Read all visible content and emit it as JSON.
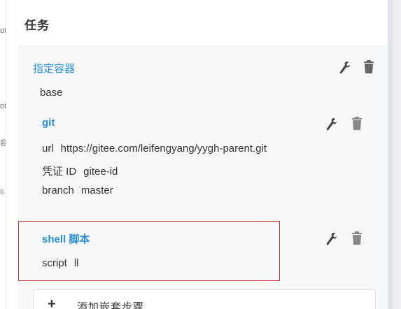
{
  "panel": {
    "title": "任务"
  },
  "left_edge_glyphs": [
    "ot",
    "ot",
    "容",
    "s"
  ],
  "steps": {
    "container": {
      "title": "指定容器",
      "value": "base"
    },
    "git": {
      "title": "git",
      "params": [
        {
          "key": "url",
          "value": "https://gitee.com/leifengyang/yygh-parent.git"
        },
        {
          "key": "凭证 ID",
          "value": "gitee-id"
        },
        {
          "key": "branch",
          "value": "master"
        }
      ]
    },
    "shell": {
      "title": "shell 脚本",
      "params": [
        {
          "key": "script",
          "value": "ll"
        }
      ]
    }
  },
  "add_nested_step": {
    "icon": "plus-icon",
    "label": "添加嵌套步骤"
  },
  "icons": {
    "edit": "wrench-icon",
    "delete": "trash-icon"
  },
  "colors": {
    "step_title": "#2b8fd6",
    "highlight_border": "#c23a3a",
    "card_bg": "#f7f8fa"
  }
}
